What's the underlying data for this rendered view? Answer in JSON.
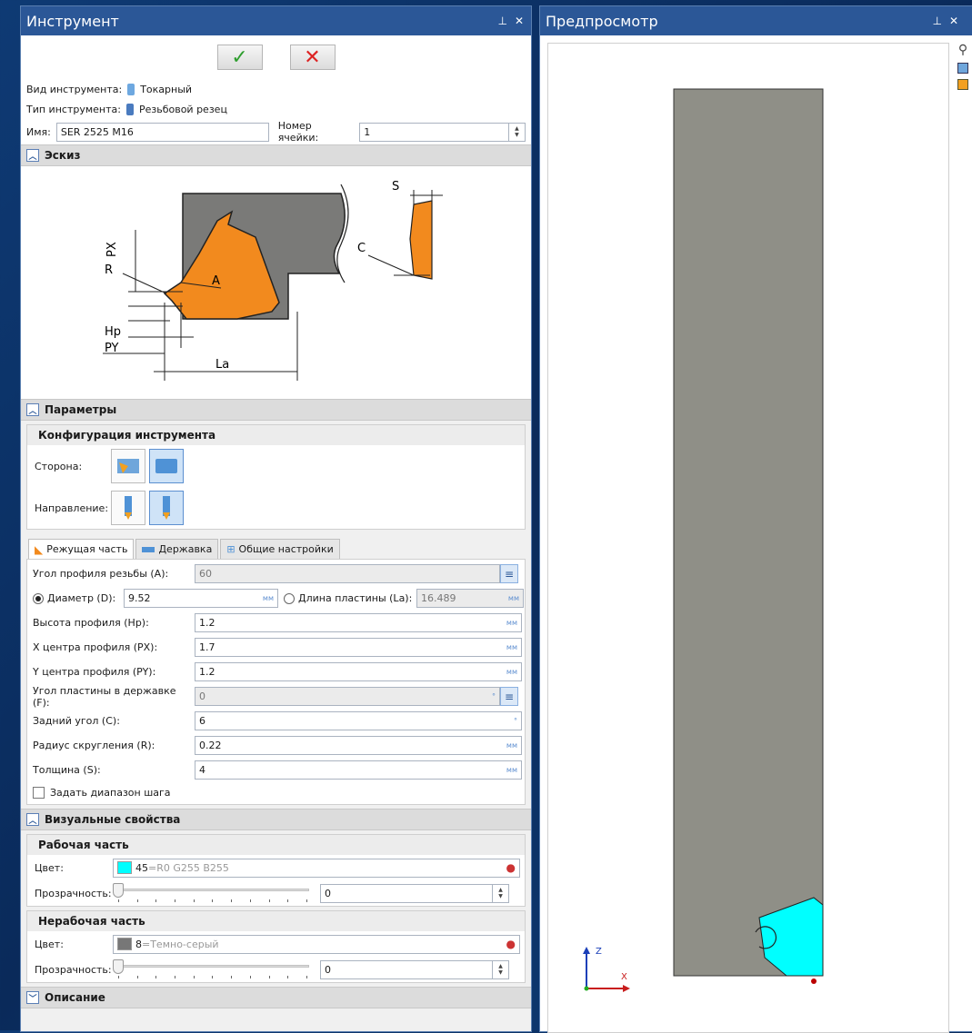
{
  "left_panel": {
    "title": "Инструмент",
    "pin_glyph": "⊥",
    "close_glyph": "✕",
    "ok_glyph": "✓",
    "cancel_glyph": "✕",
    "tool_kind_label": "Вид инструмента:",
    "tool_kind_value": "Токарный",
    "tool_type_label": "Тип инструмента:",
    "tool_type_value": "Резьбовой резец",
    "name_label": "Имя:",
    "name_value": "SER 2525 M16",
    "cell_label": "Номер ячейки:",
    "cell_value": "1",
    "sketch_section": "Эскиз",
    "params_section": "Параметры",
    "config_title": "Конфигурация инструмента",
    "side_label": "Сторона:",
    "direction_label": "Направление:",
    "tabs": [
      {
        "label": "Режущая часть",
        "icon": "cutting-part-icon"
      },
      {
        "label": "Державка",
        "icon": "holder-icon"
      },
      {
        "label": "Общие настройки",
        "icon": "settings-icon"
      }
    ],
    "params": {
      "thread_angle_label": "Угол профиля резьбы (A):",
      "thread_angle_value": "60",
      "diameter_label": "Диаметр (D):",
      "diameter_value": "9.52",
      "plate_len_label": "Длина пластины (La):",
      "plate_len_value": "16.489",
      "rows": [
        {
          "label": "Высота профиля (Hp):",
          "value": "1.2",
          "unit": "мм"
        },
        {
          "label": "X центра профиля (PX):",
          "value": "1.7",
          "unit": "мм"
        },
        {
          "label": "Y центра профиля (PY):",
          "value": "1.2",
          "unit": "мм"
        }
      ],
      "plate_angle_label": "Угол пластины в державке (F):",
      "plate_angle_value": "0",
      "rows2": [
        {
          "label": "Задний угол (C):",
          "value": "6",
          "unit": "°"
        },
        {
          "label": "Радиус скругления (R):",
          "value": "0.22",
          "unit": "мм"
        },
        {
          "label": "Толщина (S):",
          "value": "4",
          "unit": "мм"
        }
      ],
      "unit_mm": "мм",
      "unit_deg": "°",
      "step_range_label": "Задать диапазон шага"
    },
    "visual_section": "Визуальные свойства",
    "working_part_title": "Рабочая часть",
    "color_label": "Цвет:",
    "working_color_index": "45",
    "working_color_text": "=R0 G255 B255",
    "working_color_hex": "#00ffff",
    "transparency_label": "Прозрачность:",
    "working_transparency": "0",
    "nonworking_part_title": "Нерабочая часть",
    "nonworking_color_index": "8",
    "nonworking_color_text": "=Темно-серый",
    "nonworking_color_hex": "#777777",
    "nonworking_transparency": "0",
    "description_section": "Описание"
  },
  "sketch_labels": {
    "S": "S",
    "C": "C",
    "PX": "PX",
    "R": "R",
    "A": "A",
    "Hp": "Hp",
    "PY": "PY",
    "La": "La"
  },
  "right_panel": {
    "title": "Предпросмотр",
    "pin_glyph": "⊥",
    "close_glyph": "✕",
    "axis_z": "Z",
    "axis_x": "X"
  },
  "colors": {
    "header": "#2b5797",
    "orange": "#f28a1e",
    "holder_gray": "#8f8f87",
    "cyan": "#00ffff"
  }
}
